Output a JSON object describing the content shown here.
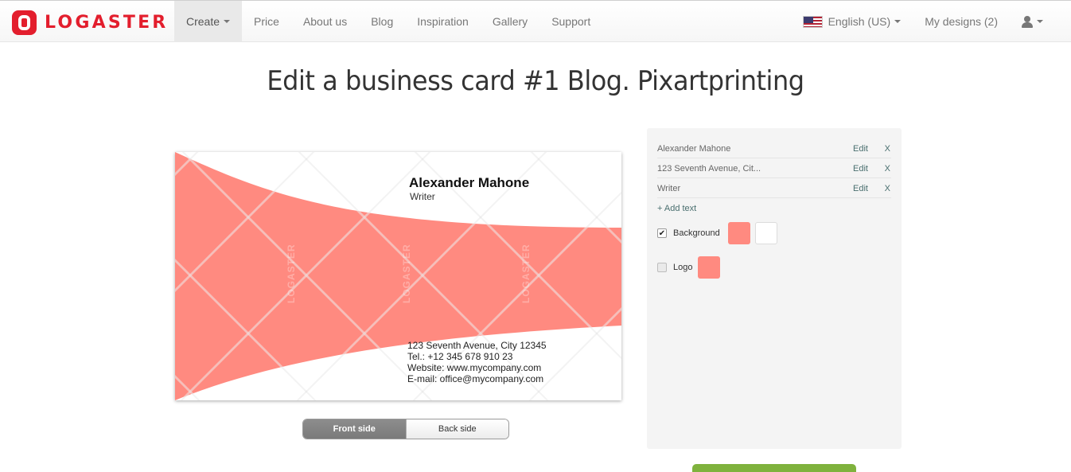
{
  "brand": {
    "name": "LOGASTER",
    "color": "#e31e2d"
  },
  "nav": {
    "items": [
      {
        "label": "Create",
        "has_caret": true,
        "active": true
      },
      {
        "label": "Price"
      },
      {
        "label": "About us"
      },
      {
        "label": "Blog"
      },
      {
        "label": "Inspiration"
      },
      {
        "label": "Gallery"
      },
      {
        "label": "Support"
      }
    ],
    "language": "English (US)",
    "my_designs": "My designs (2)",
    "user_icon": "user-icon"
  },
  "page_title": "Edit a business card #1 Blog. Pixartprinting",
  "card": {
    "name": "Alexander Mahone",
    "title": "Writer",
    "contact": [
      "123 Seventh Avenue, City 12345",
      "Tel.: +12 345 678 910 23",
      "Website: www.mycompany.com",
      "E-mail: office@mycompany.com"
    ],
    "watermark": "LOGASTER",
    "accent_color": "#ff8a80"
  },
  "side_toggle": {
    "front": "Front side",
    "back": "Back side",
    "selected": "front"
  },
  "panel": {
    "text_rows": [
      {
        "label": "Alexander Mahone",
        "edit": "Edit",
        "delete": "X"
      },
      {
        "label": "123 Seventh Avenue, Cit...",
        "edit": "Edit",
        "delete": "X"
      },
      {
        "label": "Writer",
        "edit": "Edit",
        "delete": "X"
      }
    ],
    "add_text": "+ Add text",
    "background": {
      "label": "Background",
      "checked": true,
      "colors": [
        "#ff8a80",
        "#ffffff"
      ]
    },
    "logo": {
      "label": "Logo",
      "checked": false,
      "colors": [
        "#ff8a80"
      ]
    }
  }
}
